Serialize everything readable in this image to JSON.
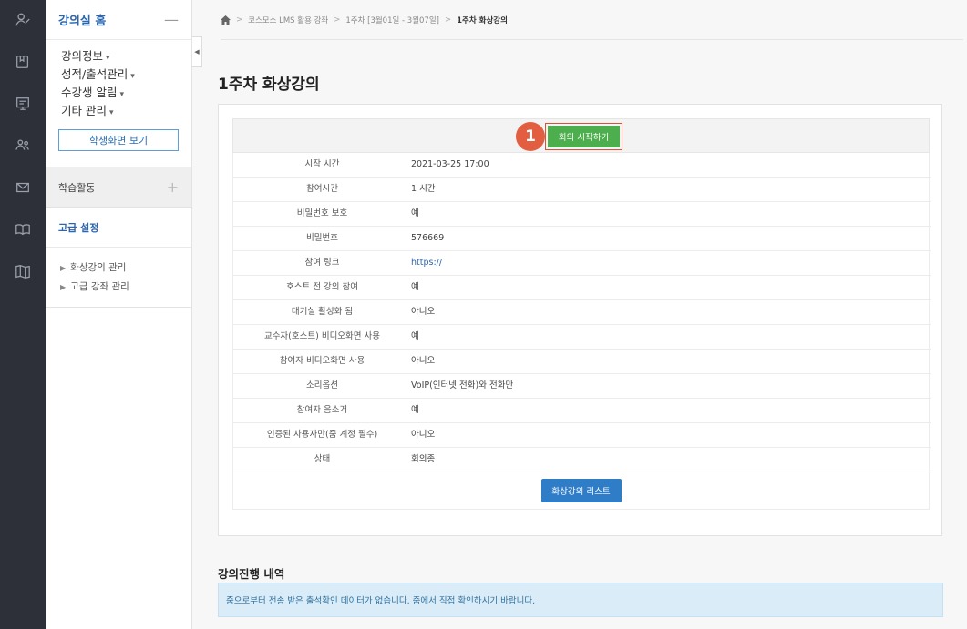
{
  "rail": {
    "icons": [
      "user-profile-icon",
      "book-icon",
      "presentation-icon",
      "people-icon",
      "mail-icon",
      "open-book-icon",
      "map-icon"
    ]
  },
  "panel": {
    "title": "강의실 홈",
    "collapse": "—",
    "menu": [
      {
        "label": "강의정보",
        "caret": "▾"
      },
      {
        "label": "성적/출석관리",
        "caret": "▾"
      },
      {
        "label": "수강생 알림",
        "caret": "▾"
      },
      {
        "label": "기타 관리",
        "caret": "▾"
      }
    ],
    "student_view_label": "학생화면 보기",
    "activity_label": "학습활동",
    "activity_plus": "+",
    "advanced_label": "고급 설정",
    "sub_items": [
      "화상강의 관리",
      "고급 강좌 관리"
    ]
  },
  "breadcrumb": {
    "items": [
      "코스모스 LMS 활용 강좌",
      "1주차 [3월01일 - 3월07일]"
    ],
    "current": "1주차 화상강의"
  },
  "page_title": "1주차 화상강의",
  "meeting": {
    "step_badge": "1",
    "start_button": "회의 시작하기",
    "rows": [
      {
        "key": "시작 시간",
        "value": "2021-03-25 17:00"
      },
      {
        "key": "참여시간",
        "value": "1 시간"
      },
      {
        "key": "비밀번호 보호",
        "value": "예"
      },
      {
        "key": "비밀번호",
        "value": "576669"
      },
      {
        "key": "참여 링크",
        "value": "https://",
        "link": true
      },
      {
        "key": "호스트 전 강의 참여",
        "value": "예"
      },
      {
        "key": "대기실 활성화 됨",
        "value": "아니오"
      },
      {
        "key": "교수자(호스트) 비디오화면 사용",
        "value": "예"
      },
      {
        "key": "참여자 비디오화면 사용",
        "value": "아니오"
      },
      {
        "key": "소리옵션",
        "value": "VoIP(인터넷 전화)와 전화만"
      },
      {
        "key": "참여자 음소거",
        "value": "예"
      },
      {
        "key": "인증된 사용자만(줌 계정 필수)",
        "value": "아니오"
      },
      {
        "key": "상태",
        "value": "회의종"
      }
    ],
    "list_button": "화상강의 리스트"
  },
  "history": {
    "title": "강의진행 내역",
    "notice": "줌으로부터 전송 받은 출석확인 데이터가 없습니다. 줌에서 직접 확인하시기 바랍니다."
  },
  "colors": {
    "rail_bg": "#2d3038",
    "accent_blue": "#2b66b1",
    "start_green": "#4cae4c",
    "badge_red": "#e35e40",
    "notice_bg": "#d9ecf7"
  }
}
